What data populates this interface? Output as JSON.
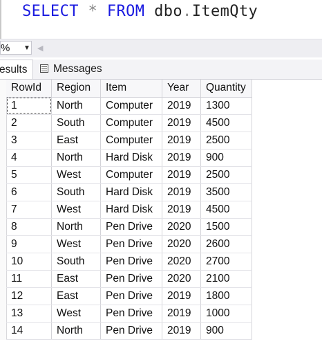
{
  "editor": {
    "keyword_select": "SELECT",
    "star": "*",
    "keyword_from": "FROM",
    "schema": "dbo",
    "dot": ".",
    "table": "ItemQty"
  },
  "zoom": {
    "value": "%"
  },
  "tabs": [
    {
      "label": "esults"
    },
    {
      "label": "Messages"
    }
  ],
  "grid": {
    "columns": [
      "RowId",
      "Region",
      "Item",
      "Year",
      "Quantity"
    ],
    "rows": [
      [
        "1",
        "North",
        "Computer",
        "2019",
        "1300"
      ],
      [
        "2",
        "South",
        "Computer",
        "2019",
        "4500"
      ],
      [
        "3",
        "East",
        "Computer",
        "2019",
        "2500"
      ],
      [
        "4",
        "North",
        "Hard Disk",
        "2019",
        "900"
      ],
      [
        "5",
        "West",
        "Computer",
        "2019",
        "2500"
      ],
      [
        "6",
        "South",
        "Hard Disk",
        "2019",
        "3500"
      ],
      [
        "7",
        "West",
        "Hard Disk",
        "2019",
        "4500"
      ],
      [
        "8",
        "North",
        "Pen Drive",
        "2020",
        "1500"
      ],
      [
        "9",
        "West",
        "Pen Drive",
        "2020",
        "2600"
      ],
      [
        "10",
        "South",
        "Pen Drive",
        "2020",
        "2700"
      ],
      [
        "11",
        "East",
        "Pen Drive",
        "2020",
        "2100"
      ],
      [
        "12",
        "East",
        "Pen Drive",
        "2019",
        "1800"
      ],
      [
        "13",
        "West",
        "Pen Drive",
        "2019",
        "1000"
      ],
      [
        "14",
        "North",
        "Pen Drive",
        "2019",
        "900"
      ]
    ]
  }
}
